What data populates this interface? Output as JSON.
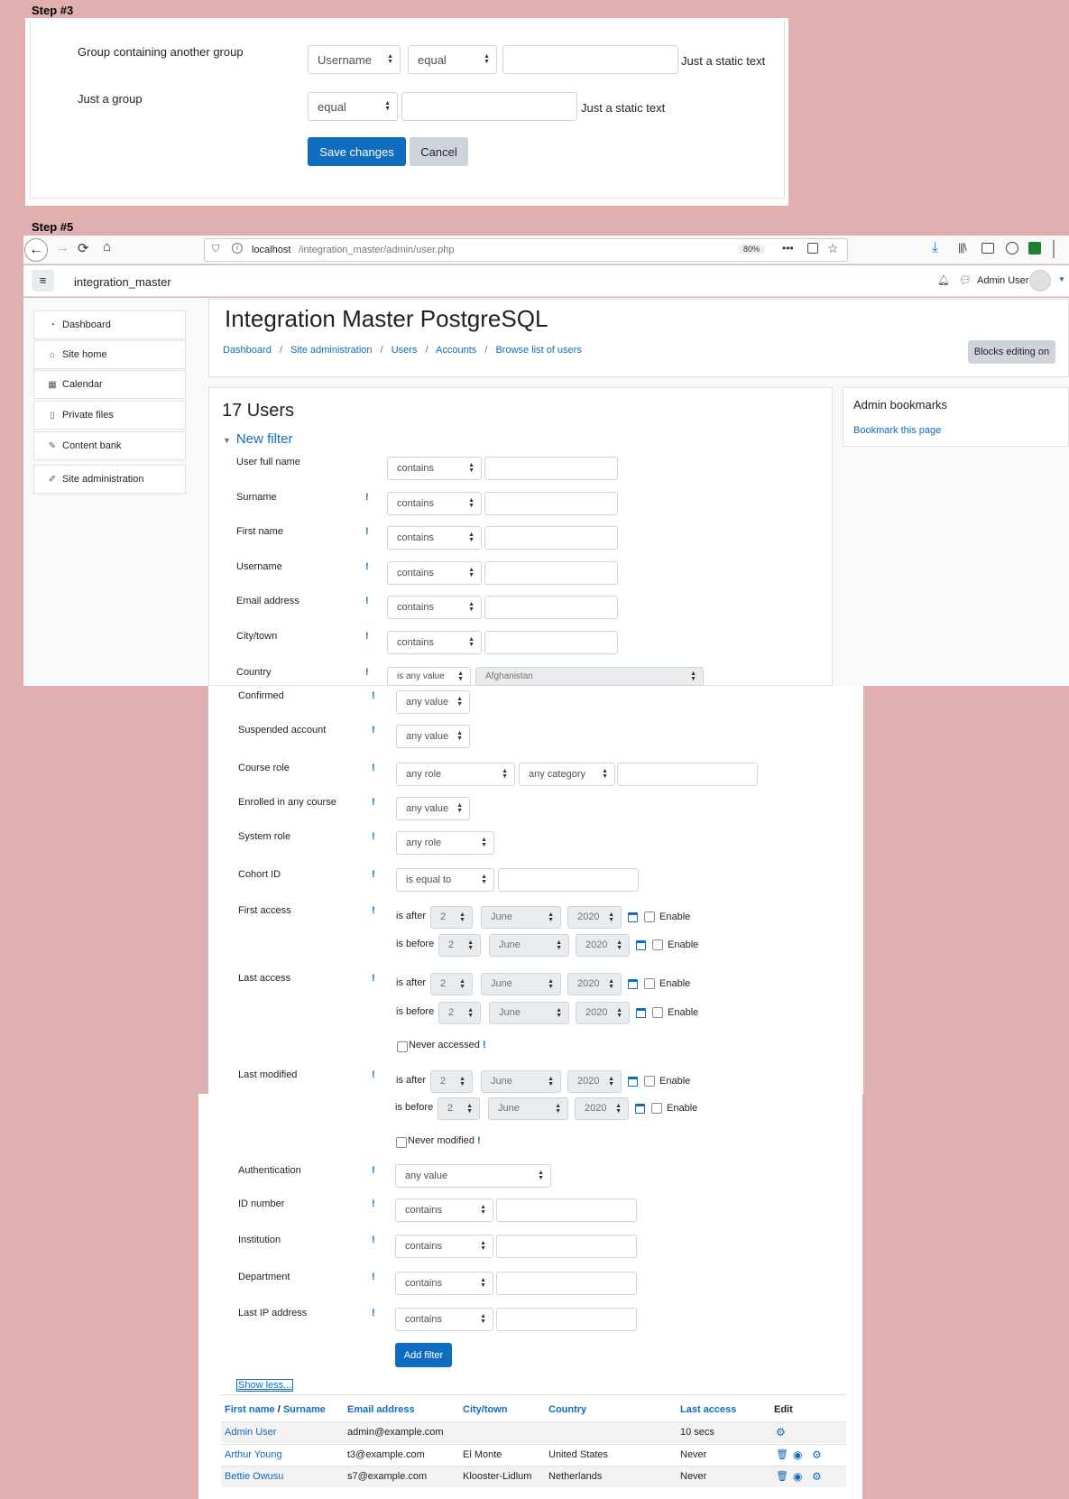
{
  "step3": {
    "label": "Step #3",
    "row1": {
      "label": "Group containing another group",
      "select1": "Username",
      "select2": "equal",
      "static": "Just a static text"
    },
    "row2": {
      "label": "Just a group",
      "select1": "equal",
      "static": "Just a static text"
    },
    "save": "Save changes",
    "cancel": "Cancel"
  },
  "step5": {
    "label": "Step #5"
  },
  "browser": {
    "url_host": "localhost",
    "url_path": "/integration_master/admin/user.php",
    "zoom": "80%",
    "dots": "•••"
  },
  "header": {
    "site_name": "integration_master",
    "user_name": "Admin User"
  },
  "sidebar": {
    "items": [
      {
        "label": "Dashboard",
        "icon": "dashboard-icon"
      },
      {
        "label": "Site home",
        "icon": "home-icon"
      },
      {
        "label": "Calendar",
        "icon": "calendar-icon"
      },
      {
        "label": "Private files",
        "icon": "file-icon"
      },
      {
        "label": "Content bank",
        "icon": "brush-icon"
      },
      {
        "label": "Site administration",
        "icon": "wrench-icon"
      }
    ]
  },
  "page": {
    "title": "Integration Master PostgreSQL",
    "breadcrumb": [
      "Dashboard",
      "Site administration",
      "Users",
      "Accounts",
      "Browse list of users"
    ],
    "blocks_button": "Blocks editing on",
    "users_count": "17 Users",
    "new_filter": "New filter"
  },
  "bookmarks": {
    "title": "Admin bookmarks",
    "link": "Bookmark this page"
  },
  "filters": {
    "user_full_name": {
      "label": "User full name",
      "op": "contains"
    },
    "surname": {
      "label": "Surname",
      "op": "contains"
    },
    "first_name": {
      "label": "First name",
      "op": "contains"
    },
    "username": {
      "label": "Username",
      "op": "contains"
    },
    "email": {
      "label": "Email address",
      "op": "contains"
    },
    "city": {
      "label": "City/town",
      "op": "contains"
    },
    "country": {
      "label": "Country",
      "op": "is any value",
      "value": "Afghanistan"
    },
    "confirmed": {
      "label": "Confirmed",
      "op": "any value"
    },
    "suspended": {
      "label": "Suspended account",
      "op": "any value"
    },
    "course_role": {
      "label": "Course role",
      "role": "any role",
      "category": "any category"
    },
    "enrolled": {
      "label": "Enrolled in any course",
      "op": "any value"
    },
    "system_role": {
      "label": "System role",
      "op": "any role"
    },
    "cohort": {
      "label": "Cohort ID",
      "op": "is equal to"
    },
    "first_access": {
      "label": "First access"
    },
    "last_access": {
      "label": "Last access"
    },
    "last_modified": {
      "label": "Last modified"
    },
    "authentication": {
      "label": "Authentication",
      "op": "any value"
    },
    "id_number": {
      "label": "ID number",
      "op": "contains"
    },
    "institution": {
      "label": "Institution",
      "op": "contains"
    },
    "department": {
      "label": "Department",
      "op": "contains"
    },
    "last_ip": {
      "label": "Last IP address",
      "op": "contains"
    }
  },
  "date": {
    "is_after": "is after",
    "is_before": "is before",
    "day": "2",
    "month": "June",
    "year": "2020",
    "enable": "Enable",
    "help": "!"
  },
  "never_accessed": "Never accessed",
  "never_modified": "Never modified",
  "add_filter": "Add filter",
  "show_less": "Show less...",
  "table": {
    "headers": {
      "first": "First name",
      "slash": " / ",
      "surname": "Surname",
      "email": "Email address",
      "city": "City/town",
      "country": "Country",
      "last": "Last access",
      "edit": "Edit"
    },
    "rows": [
      {
        "name": "Admin User",
        "email": "admin@example.com",
        "city": "",
        "country": "",
        "last": "10 secs"
      },
      {
        "name": "Arthur Young",
        "email": "t3@example.com",
        "city": "El Monte",
        "country": "United States",
        "last": "Never"
      },
      {
        "name": "Bettie Owusu",
        "email": "s7@example.com",
        "city": "Klooster-Lidlum",
        "country": "Netherlands",
        "last": "Never"
      }
    ]
  }
}
